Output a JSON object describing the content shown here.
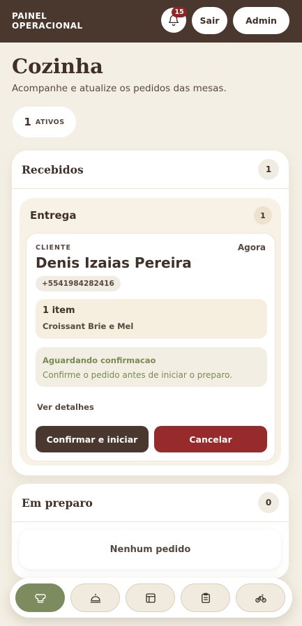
{
  "header": {
    "brand_line1": "PAINEL",
    "brand_line2": "OPERACIONAL",
    "notifications_count": "15",
    "logout_label": "Sair",
    "admin_label": "Admin"
  },
  "page": {
    "title": "Cozinha",
    "subtitle": "Acompanhe e atualize os pedidos das mesas.",
    "active_count": "1",
    "active_label": "ATIVOS"
  },
  "columns": [
    {
      "title": "Recebidos",
      "count": "1",
      "groups": [
        {
          "title": "Entrega",
          "count": "1",
          "orders": [
            {
              "client_label": "CLIENTE",
              "time": "Agora",
              "client_name": "Denis Izaias Pereira",
              "phone": "+5541984282416",
              "items_count": "1 item",
              "items_desc": "Croissant Brie e Mel",
              "status_title": "Aguardando confirmacao",
              "status_desc": "Confirme o pedido antes de iniciar o preparo.",
              "details_label": "Ver detalhes",
              "confirm_label": "Confirmar e iniciar",
              "cancel_label": "Cancelar"
            }
          ]
        }
      ]
    },
    {
      "title": "Em preparo",
      "count": "0",
      "empty_label": "Nenhum pedido"
    }
  ],
  "bottom_nav": {
    "items": [
      {
        "icon": "chef-hat-icon",
        "active": true
      },
      {
        "icon": "cloche-icon",
        "active": false
      },
      {
        "icon": "table-layout-icon",
        "active": false
      },
      {
        "icon": "clipboard-icon",
        "active": false
      },
      {
        "icon": "bicycle-icon",
        "active": false
      }
    ]
  },
  "colors": {
    "topbar": "#4a372d",
    "background": "#f4efe4",
    "primary_button": "#4a372d",
    "danger_button": "#972a2a",
    "active_nav": "#7d8c5e",
    "status_text": "#7b8a52",
    "badge": "#8f2525"
  }
}
